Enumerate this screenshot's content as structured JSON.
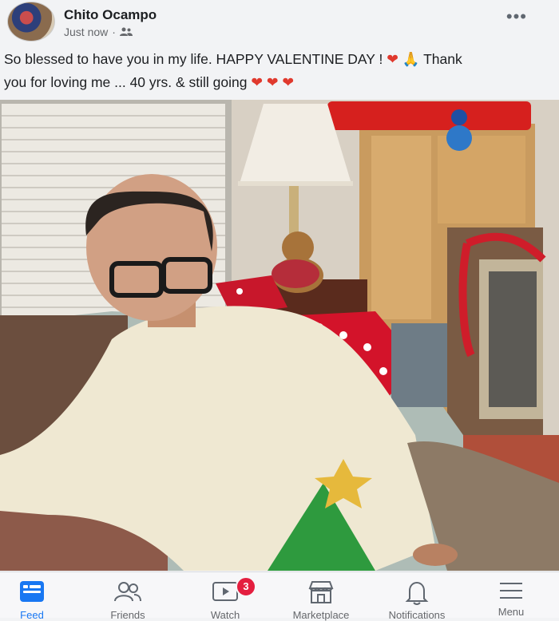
{
  "post": {
    "author": "Chito Ocampo",
    "timestamp": "Just now",
    "audience_icon": "friends-icon",
    "caption_line1": "So blessed to have you in my life. HAPPY VALENTINE DAY !",
    "caption_line1_end": "Thank",
    "caption_line2": "you for loving me ... 40 yrs. & still going",
    "more_icon": "•••"
  },
  "tabbar": {
    "tabs": [
      {
        "label": "Feed",
        "icon": "feed-icon",
        "active": true
      },
      {
        "label": "Friends",
        "icon": "friends-icon"
      },
      {
        "label": "Watch",
        "icon": "watch-icon",
        "badge": "3"
      },
      {
        "label": "Marketplace",
        "icon": "marketplace-icon"
      },
      {
        "label": "Notifications",
        "icon": "bell-icon"
      },
      {
        "label": "Menu",
        "icon": "menu-icon"
      }
    ]
  },
  "colors": {
    "accent": "#1877f2",
    "badge": "#e41e3f",
    "heart": "#e0392d"
  }
}
